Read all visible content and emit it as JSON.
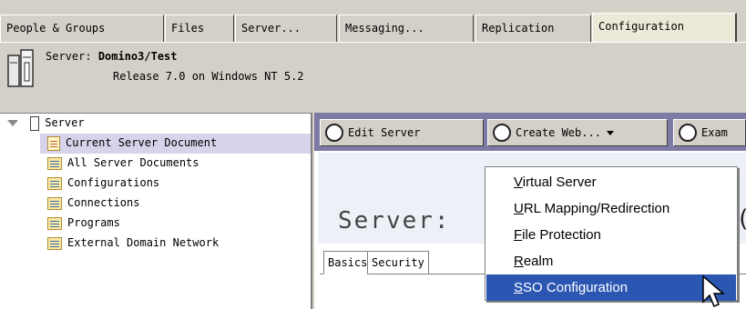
{
  "tabs": [
    {
      "label": "People & Groups"
    },
    {
      "label": "Files"
    },
    {
      "label": "Server..."
    },
    {
      "label": "Messaging..."
    },
    {
      "label": "Replication"
    },
    {
      "label": "Configuration",
      "active": true
    }
  ],
  "header": {
    "server_prefix": "Server:",
    "server_name": "Domino3/Test",
    "release": "Release 7.0 on Windows NT 5.2"
  },
  "nav": {
    "root": "Server",
    "items": [
      {
        "label": "Current Server Document",
        "icon": "document-icon",
        "selected": true
      },
      {
        "label": "All Server Documents",
        "icon": "view-icon"
      },
      {
        "label": "Configurations",
        "icon": "view-icon"
      },
      {
        "label": "Connections",
        "icon": "view-icon"
      },
      {
        "label": "Programs",
        "icon": "view-icon"
      },
      {
        "label": "External Domain Network",
        "icon": "view-icon"
      }
    ]
  },
  "actions": {
    "edit": "Edit Server",
    "create": "Create Web...",
    "examine": "Exam"
  },
  "document": {
    "title": "Server:",
    "title_tail": "(",
    "tabs": [
      "Basics",
      "Security"
    ]
  },
  "menu": {
    "items": [
      {
        "accel": "V",
        "rest": "irtual Server"
      },
      {
        "accel": "U",
        "rest": "RL Mapping/Redirection"
      },
      {
        "accel": "F",
        "rest": "ile Protection"
      },
      {
        "accel": "R",
        "rest": "ealm"
      },
      {
        "accel": "S",
        "rest": "SO Configuration",
        "highlighted": true
      }
    ]
  },
  "colors": {
    "action_bar": "#7e7aa6",
    "menu_highlight": "#2b57b3",
    "nav_selected": "#d6d3ea"
  }
}
